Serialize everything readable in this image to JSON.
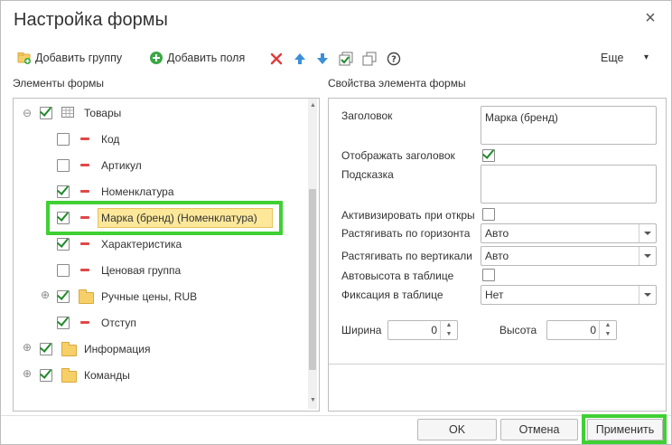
{
  "dialog": {
    "title": "Настройка формы",
    "close_symbol": "×"
  },
  "toolbar": {
    "add_group": "Добавить группу",
    "add_fields": "Добавить поля",
    "more": "Еще",
    "more_arrow": "▾"
  },
  "left_panel": {
    "header": "Элементы формы",
    "items": [
      {
        "label": "Товары",
        "checked": true,
        "icon": "table-icon",
        "expanded": true
      },
      {
        "label": "Код",
        "checked": false,
        "icon": "field-icon"
      },
      {
        "label": "Артикул",
        "checked": false,
        "icon": "field-icon"
      },
      {
        "label": "Номенклатура",
        "checked": true,
        "icon": "field-icon"
      },
      {
        "label": "Марка (бренд) (Номенклатура)",
        "checked": true,
        "icon": "field-icon",
        "selected": true
      },
      {
        "label": "Характеристика",
        "checked": true,
        "icon": "field-icon"
      },
      {
        "label": "Ценовая группа",
        "checked": false,
        "icon": "field-icon"
      },
      {
        "label": "Ручные цены, RUB",
        "checked": true,
        "icon": "folder-icon",
        "expandable": true
      },
      {
        "label": "Отступ",
        "checked": true,
        "icon": "field-icon"
      },
      {
        "label": "Информация",
        "checked": true,
        "icon": "folder-icon",
        "expandable": true
      },
      {
        "label": "Команды",
        "checked": true,
        "icon": "folder-icon",
        "expandable": true
      }
    ]
  },
  "right_panel": {
    "header": "Свойства элемента формы",
    "title_label": "Заголовок",
    "title_value": "Марка (бренд)",
    "show_title_label": "Отображать заголовок",
    "show_title_checked": true,
    "hint_label": "Подсказка",
    "hint_value": "",
    "activate_label": "Активизировать при откры",
    "activate_checked": false,
    "stretch_h_label": "Растягивать по горизонта",
    "stretch_h_value": "Авто",
    "stretch_v_label": "Растягивать по вертикали",
    "stretch_v_value": "Авто",
    "autoheight_label": "Автовысота в таблице",
    "autoheight_checked": false,
    "fix_label": "Фиксация в таблице",
    "fix_value": "Нет",
    "width_label": "Ширина",
    "width_value": "0",
    "height_label": "Высота",
    "height_value": "0"
  },
  "footer": {
    "ok": "OK",
    "cancel": "Отмена",
    "apply": "Применить"
  },
  "colors": {
    "highlight": "#3fd033",
    "selected_bg": "#fde89a",
    "check": "#1f8a2a"
  }
}
